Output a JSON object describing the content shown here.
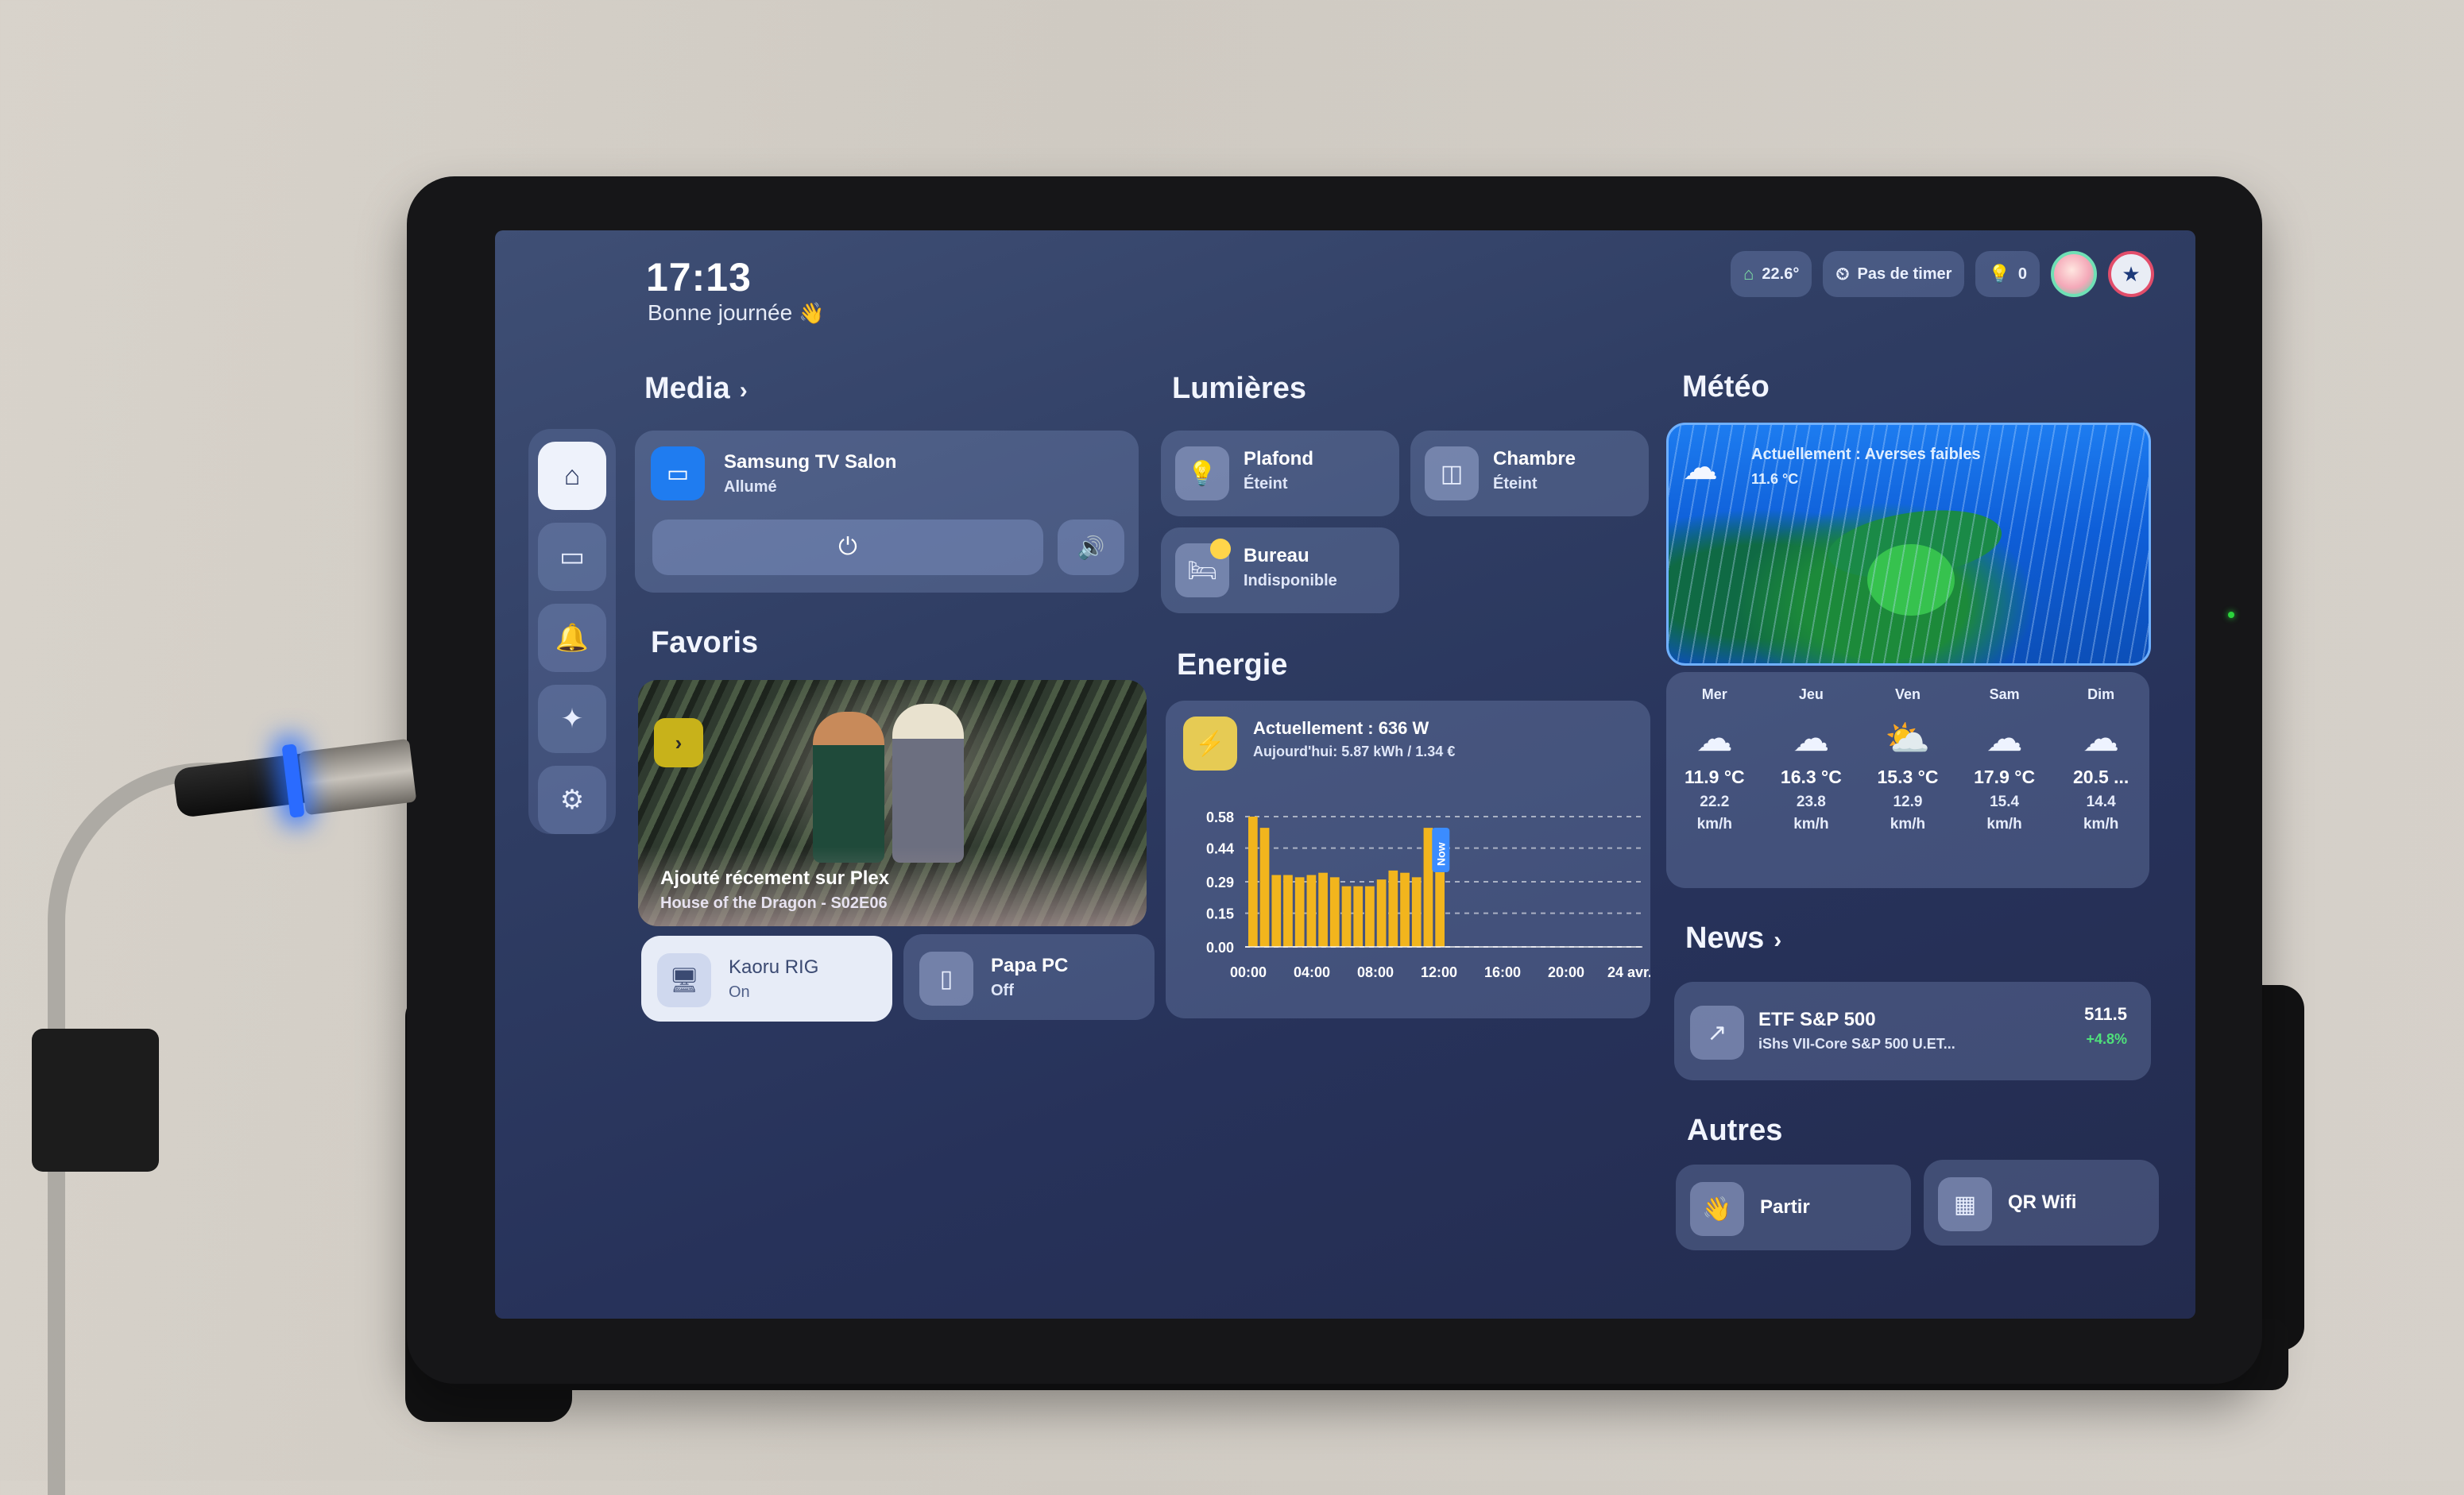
{
  "header": {
    "time": "17:13",
    "greeting": "Bonne journée",
    "wave_icon": "👋",
    "chips": {
      "temperature": "22.6°",
      "timer": "Pas de timer",
      "lights_on": "0"
    }
  },
  "sidebar": {
    "items": [
      {
        "name": "home",
        "icon": "⌂"
      },
      {
        "name": "devices",
        "icon": "▭"
      },
      {
        "name": "notifications",
        "icon": "🔔"
      },
      {
        "name": "ai",
        "icon": "✦"
      },
      {
        "name": "settings",
        "icon": "⚙"
      }
    ]
  },
  "media": {
    "title": "Media",
    "chevron": "›",
    "device_name": "Samsung TV Salon",
    "device_state": "Allumé",
    "power_icon": "⏻",
    "volume_icon": "🔊"
  },
  "lights": {
    "title": "Lumières",
    "items": [
      {
        "name": "Plafond",
        "state": "Éteint",
        "icon": "💡"
      },
      {
        "name": "Chambre",
        "state": "Éteint",
        "icon": "◫"
      },
      {
        "name": "Bureau",
        "state": "Indisponible",
        "icon": "🛏"
      }
    ]
  },
  "favoris": {
    "title": "Favoris",
    "plex_badge": "›",
    "plex_title": "Ajouté récement sur Plex",
    "plex_subtitle": "House of the Dragon - S02E06",
    "pcs": [
      {
        "name": "Kaoru RIG",
        "state": "On",
        "icon": "🖥"
      },
      {
        "name": "Papa PC",
        "state": "Off",
        "icon": "▯"
      }
    ]
  },
  "energy": {
    "title": "Energie",
    "icon": "⚡",
    "current": "Actuellement : 636 W",
    "today": "Aujourd'hui: 5.87 kWh / 1.34 €"
  },
  "chart_data": {
    "type": "bar",
    "title": "",
    "xlabel": "",
    "ylabel": "",
    "ylim": [
      0,
      0.58
    ],
    "y_ticks": [
      "0.58",
      "0.44",
      "0.29",
      "0.15",
      "0.00"
    ],
    "x_ticks": [
      "00:00",
      "04:00",
      "08:00",
      "12:00",
      "16:00",
      "20:00",
      "24 avr."
    ],
    "now_label": "Now",
    "color": "#f2b51d",
    "values": [
      0.58,
      0.53,
      0.32,
      0.32,
      0.31,
      0.32,
      0.33,
      0.31,
      0.27,
      0.27,
      0.27,
      0.3,
      0.34,
      0.33,
      0.31,
      0.53,
      0.4
    ]
  },
  "meteo": {
    "title": "Météo",
    "current_condition": "Actuellement : Averses faibles",
    "current_temp": "11.6 °C",
    "forecast": [
      {
        "day": "Mer",
        "temp": "11.9 °C",
        "wind": "22.2",
        "unit": "km/h",
        "icon": "☁"
      },
      {
        "day": "Jeu",
        "temp": "16.3 °C",
        "wind": "23.8",
        "unit": "km/h",
        "icon": "☁"
      },
      {
        "day": "Ven",
        "temp": "15.3 °C",
        "wind": "12.9",
        "unit": "km/h",
        "icon": "⛅"
      },
      {
        "day": "Sam",
        "temp": "17.9 °C",
        "wind": "15.4",
        "unit": "km/h",
        "icon": "☁"
      },
      {
        "day": "Dim",
        "temp": "20.5 ...",
        "wind": "14.4",
        "unit": "km/h",
        "icon": "☁"
      }
    ]
  },
  "news": {
    "title": "News",
    "chevron": "›",
    "ticker": "ETF S&P 500",
    "description": "iShs VII-Core S&P 500 U.ET...",
    "price": "511.5",
    "change": "+4.8%",
    "icon": "↗"
  },
  "autres": {
    "title": "Autres",
    "items": [
      {
        "name": "Partir",
        "icon": "👋"
      },
      {
        "name": "QR Wifi",
        "icon": "▦"
      }
    ]
  }
}
